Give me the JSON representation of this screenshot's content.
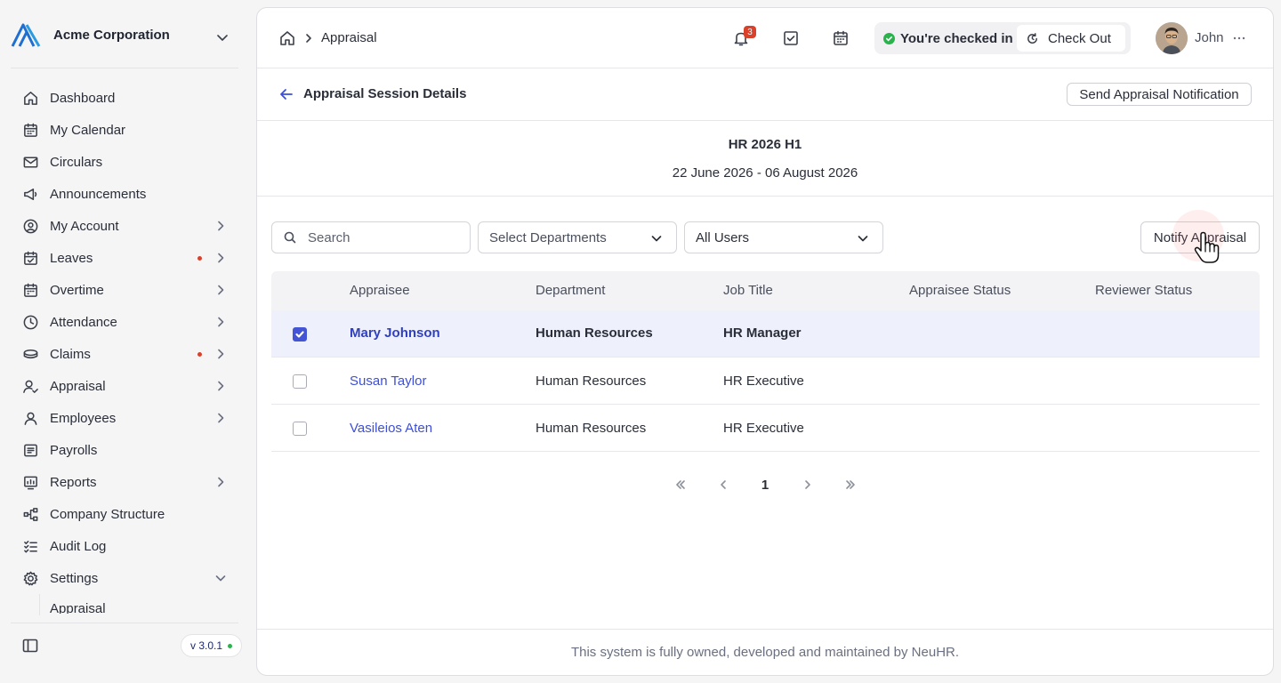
{
  "org": {
    "name": "Acme Corporation"
  },
  "sidebar": {
    "items": [
      {
        "label": "Dashboard",
        "icon": "home-icon"
      },
      {
        "label": "My Calendar",
        "icon": "calendar-icon"
      },
      {
        "label": "Circulars",
        "icon": "mail-icon"
      },
      {
        "label": "Announcements",
        "icon": "megaphone-icon"
      },
      {
        "label": "My Account",
        "icon": "user-circle-icon",
        "expandable": true
      },
      {
        "label": "Leaves",
        "icon": "calendar-check-icon",
        "expandable": true,
        "dot": true
      },
      {
        "label": "Overtime",
        "icon": "calendar-icon",
        "expandable": true
      },
      {
        "label": "Attendance",
        "icon": "clock-icon",
        "expandable": true
      },
      {
        "label": "Claims",
        "icon": "coins-icon",
        "expandable": true,
        "dot": true
      },
      {
        "label": "Appraisal",
        "icon": "user-check-icon",
        "expandable": true
      },
      {
        "label": "Employees",
        "icon": "user-icon",
        "expandable": true
      },
      {
        "label": "Payrolls",
        "icon": "receipt-icon"
      },
      {
        "label": "Reports",
        "icon": "chart-icon",
        "expandable": true
      },
      {
        "label": "Company Structure",
        "icon": "org-chart-icon"
      },
      {
        "label": "Audit Log",
        "icon": "checklist-icon"
      },
      {
        "label": "Settings",
        "icon": "gear-icon",
        "expanded": true
      }
    ],
    "sub_item": "Appraisal",
    "version": "v 3.0.1"
  },
  "topbar": {
    "breadcrumb": "Appraisal",
    "notification_count": "3",
    "checkin_status": "You're checked in",
    "checkout_label": "Check Out",
    "user_name": "John"
  },
  "page": {
    "title": "Appraisal Session Details",
    "send_button": "Send Appraisal Notification",
    "session_name": "HR 2026 H1",
    "session_dates": "22 June 2026 - 06 August 2026"
  },
  "filters": {
    "search_placeholder": "Search",
    "departments_placeholder": "Select Departments",
    "users_value": "All Users",
    "notify_button": "Notify Appraisal"
  },
  "table": {
    "columns": [
      "Appraisee",
      "Department",
      "Job Title",
      "Appraisee Status",
      "Reviewer Status"
    ],
    "rows": [
      {
        "name": "Mary Johnson",
        "department": "Human Resources",
        "job_title": "HR Manager",
        "appraisee_status": "",
        "reviewer_status": "",
        "selected": true
      },
      {
        "name": "Susan Taylor",
        "department": "Human Resources",
        "job_title": "HR Executive",
        "appraisee_status": "",
        "reviewer_status": "",
        "selected": false
      },
      {
        "name": "Vasileios Aten",
        "department": "Human Resources",
        "job_title": "HR Executive",
        "appraisee_status": "",
        "reviewer_status": "",
        "selected": false
      }
    ]
  },
  "pagination": {
    "current_page": "1"
  },
  "footer": {
    "text": "This system is fully owned, developed and maintained by NeuHR."
  },
  "colors": {
    "accent": "#3d4fd6",
    "checkin_green": "#2bb24c",
    "alert_red": "#d9412b"
  }
}
